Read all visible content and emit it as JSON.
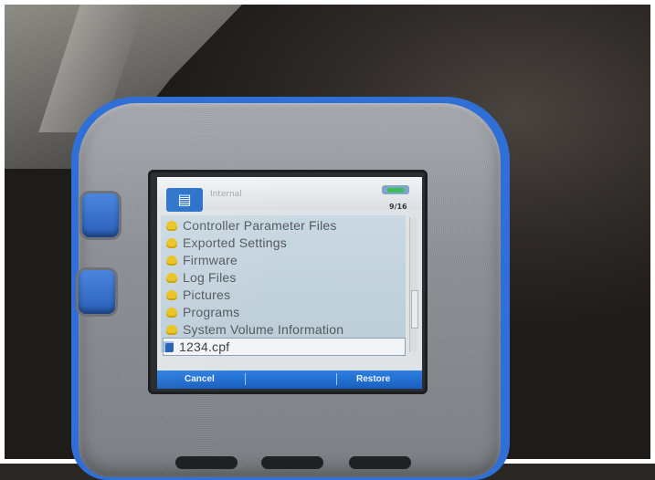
{
  "screen": {
    "location": "Internal",
    "counter": "9/16",
    "folders": [
      "Controller Parameter Files",
      "Exported Settings",
      "Firmware",
      "Log Files",
      "Pictures",
      "Programs",
      "System Volume Information"
    ],
    "selected_file": "1234.cpf",
    "softkeys": {
      "left": "Cancel",
      "right": "Restore"
    }
  },
  "icons": {
    "title": "folder-icon",
    "folder": "folder-icon",
    "file": "file-icon",
    "status": "battery-icon"
  },
  "colors": {
    "device_accent": "#2f6fd6",
    "softkey_bar": "#1a5fbf",
    "folder_icon": "#e8c21a"
  }
}
